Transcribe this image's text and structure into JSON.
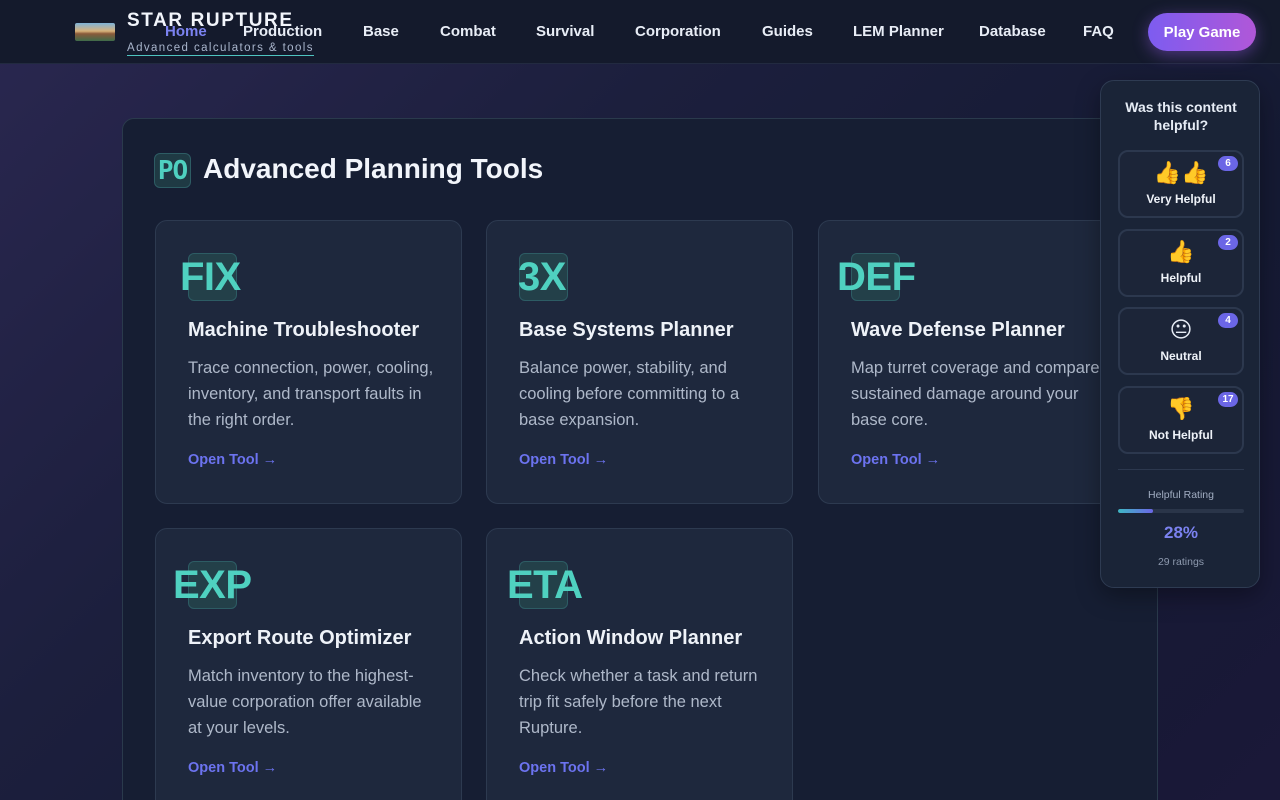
{
  "brand": {
    "title": "STAR RUPTURE",
    "subtitle": "Advanced calculators & tools"
  },
  "nav": {
    "items": [
      {
        "label": "Home",
        "active": true
      },
      {
        "label": "Production"
      },
      {
        "label": "Base"
      },
      {
        "label": "Combat"
      },
      {
        "label": "Survival"
      },
      {
        "label": "Corporation"
      },
      {
        "label": "Guides"
      },
      {
        "label": "LEM Planner"
      },
      {
        "label": "Database"
      },
      {
        "label": "FAQ"
      }
    ],
    "cta": "Play Game"
  },
  "main": {
    "badge": "PO",
    "title": "Advanced Planning Tools",
    "cards": [
      {
        "code": "FIX",
        "title": "Machine Troubleshooter",
        "description": "Trace connection, power, cooling, inventory, and transport faults in the right order.",
        "link": "Open Tool →"
      },
      {
        "code": "3X",
        "title": "Base Systems Planner",
        "description": "Balance power, stability, and cooling before committing to a base expansion.",
        "link": "Open Tool →"
      },
      {
        "code": "DEF",
        "title": "Wave Defense Planner",
        "description": "Map turret coverage and compare sustained damage around your base core.",
        "link": "Open Tool →"
      },
      {
        "code": "EXP",
        "title": "Export Route Optimizer",
        "description": "Match inventory to the highest-value corporation offer available at your levels.",
        "link": "Open Tool →"
      },
      {
        "code": "ETA",
        "title": "Action Window Planner",
        "description": "Check whether a task and return trip fit safely before the next Rupture.",
        "link": "Open Tool →"
      }
    ]
  },
  "feedback": {
    "question": "Was this content helpful?",
    "options": [
      {
        "emoji": "👍👍",
        "label": "Very Helpful",
        "count": "6"
      },
      {
        "emoji": "👍",
        "label": "Helpful",
        "count": "2"
      },
      {
        "emoji": "😐",
        "label": "Neutral",
        "count": "4"
      },
      {
        "emoji": "👎",
        "label": "Not Helpful",
        "count": "17"
      }
    ],
    "rating_label": "Helpful Rating",
    "rating_fraction": 0.28,
    "rating_percent": "28%",
    "total": "29 ratings"
  },
  "colors": {
    "accent": "#6b66e6",
    "teal": "#4fd1c0"
  }
}
